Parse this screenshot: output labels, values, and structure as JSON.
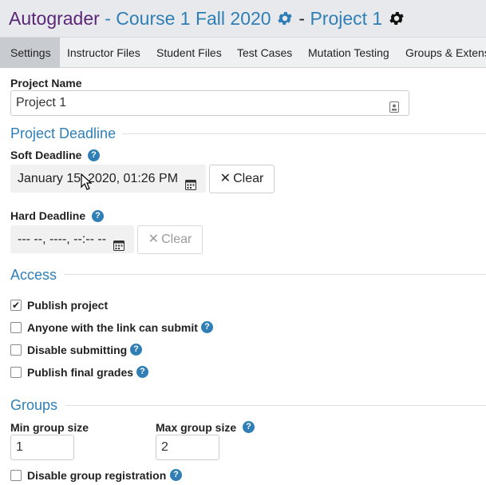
{
  "header": {
    "app": "Autograder",
    "course": "- Course 1 Fall 2020",
    "separator": "-",
    "project": "Project 1"
  },
  "tabs": [
    "Settings",
    "Instructor Files",
    "Student Files",
    "Test Cases",
    "Mutation Testing",
    "Groups & Extens"
  ],
  "active_tab": "Settings",
  "form": {
    "project_name_label": "Project Name",
    "project_name_value": "Project 1",
    "deadline_section": "Project Deadline",
    "soft_deadline_label": "Soft Deadline",
    "soft_deadline_value": "January 15, 2020, 01:26 PM",
    "clear_label": "Clear",
    "hard_deadline_label": "Hard Deadline",
    "hard_deadline_value": "--- --, ----, --:-- --",
    "hard_clear_label": "Clear",
    "access_section": "Access",
    "access_options": [
      {
        "label": "Publish project",
        "checked": true
      },
      {
        "label": "Anyone with the link can submit",
        "checked": false
      },
      {
        "label": "Disable submitting",
        "checked": false
      },
      {
        "label": "Publish final grades",
        "checked": false
      }
    ],
    "groups_section": "Groups",
    "min_group_label": "Min group size",
    "min_group_value": "1",
    "max_group_label": "Max group size",
    "max_group_value": "2",
    "disable_group_reg_label": "Disable group registration",
    "help_glyph": "?",
    "check_glyph": "✔",
    "clear_glyph": "✕"
  },
  "colors": {
    "app": "#5a2678",
    "link": "#2f7fb6",
    "tab_bar": "#eef0f2",
    "active_tab": "#c8ccd1"
  }
}
